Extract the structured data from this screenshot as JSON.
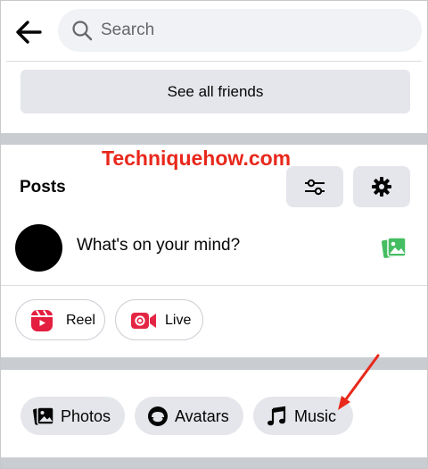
{
  "header": {
    "back_icon": "arrow-left-icon",
    "search_placeholder": "Search"
  },
  "friends": {
    "see_all_label": "See all friends"
  },
  "watermark": "Techniquehow.com",
  "posts": {
    "title": "Posts",
    "filter_icon": "sliders-icon",
    "settings_icon": "gear-icon",
    "composer_prompt": "What's on your mind?",
    "chips": [
      {
        "label": "Reel",
        "icon": "reel-icon",
        "color": "#e41e3f"
      },
      {
        "label": "Live",
        "icon": "live-video-icon",
        "color": "#e42645"
      }
    ]
  },
  "create_options": [
    {
      "label": "Photos",
      "icon": "photos-icon"
    },
    {
      "label": "Avatars",
      "icon": "avatar-icon"
    },
    {
      "label": "Music",
      "icon": "music-note-icon"
    }
  ],
  "colors": {
    "accent_red": "#e8281b",
    "photo_green": "#45bd62",
    "chip_bg": "#e4e6eb",
    "divider": "#c9ccd1"
  }
}
